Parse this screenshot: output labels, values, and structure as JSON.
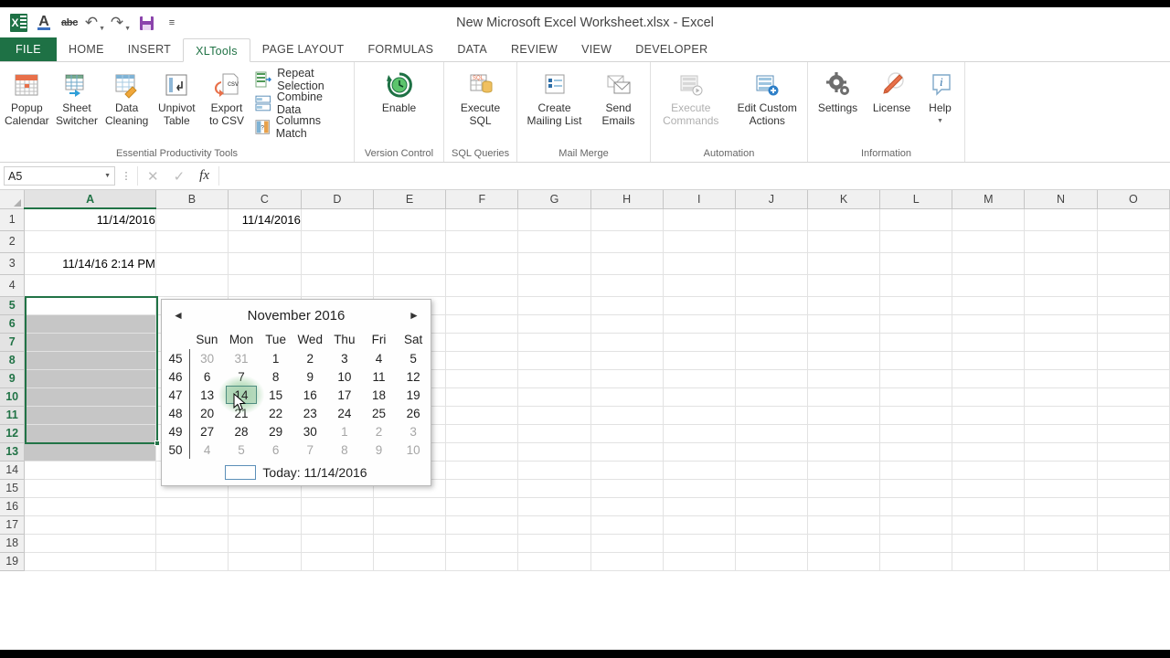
{
  "window": {
    "title": "New Microsoft Excel Worksheet.xlsx - Excel"
  },
  "quick_access": {
    "items": [
      {
        "name": "excel-logo",
        "label": "X"
      },
      {
        "name": "font-color-icon",
        "label": "A"
      },
      {
        "name": "strikethrough-icon",
        "label": "abc"
      },
      {
        "name": "undo-icon",
        "label": "↶"
      },
      {
        "name": "redo-icon",
        "label": "↷"
      },
      {
        "name": "save-icon",
        "label": "save"
      },
      {
        "name": "customize-qat-icon",
        "label": "≡"
      }
    ]
  },
  "ribbon": {
    "tabs": [
      {
        "label": "FILE",
        "active": false,
        "file": true
      },
      {
        "label": "HOME",
        "active": false
      },
      {
        "label": "INSERT",
        "active": false
      },
      {
        "label": "XLTools",
        "active": true
      },
      {
        "label": "PAGE LAYOUT",
        "active": false
      },
      {
        "label": "FORMULAS",
        "active": false
      },
      {
        "label": "DATA",
        "active": false
      },
      {
        "label": "REVIEW",
        "active": false
      },
      {
        "label": "VIEW",
        "active": false
      },
      {
        "label": "DEVELOPER",
        "active": false
      }
    ],
    "groups": [
      {
        "label": "Essential Productivity Tools",
        "big_buttons": [
          {
            "label_line1": "Popup",
            "label_line2": "Calendar",
            "icon": "calendar-icon",
            "disabled": false
          },
          {
            "label_line1": "Sheet",
            "label_line2": "Switcher",
            "icon": "sheet-switcher-icon",
            "disabled": false
          },
          {
            "label_line1": "Data",
            "label_line2": "Cleaning",
            "icon": "data-cleaning-icon",
            "disabled": false
          },
          {
            "label_line1": "Unpivot",
            "label_line2": "Table",
            "icon": "unpivot-table-icon",
            "disabled": false
          },
          {
            "label_line1": "Export",
            "label_line2": "to CSV",
            "icon": "export-csv-icon",
            "disabled": false
          }
        ],
        "small_buttons": [
          {
            "label": "Repeat Selection",
            "icon": "repeat-selection-icon"
          },
          {
            "label": "Combine Data",
            "icon": "combine-data-icon"
          },
          {
            "label": "Columns Match",
            "icon": "columns-match-icon"
          }
        ]
      },
      {
        "label": "Version Control",
        "big_buttons": [
          {
            "label_line1": "Enable",
            "label_line2": "",
            "icon": "enable-version-control-icon",
            "disabled": false
          }
        ],
        "small_buttons": []
      },
      {
        "label": "SQL Queries",
        "big_buttons": [
          {
            "label_line1": "Execute",
            "label_line2": "SQL",
            "icon": "execute-sql-icon",
            "disabled": false
          }
        ],
        "small_buttons": []
      },
      {
        "label": "Mail Merge",
        "big_buttons": [
          {
            "label_line1": "Create",
            "label_line2": "Mailing List",
            "icon": "create-mailing-list-icon",
            "disabled": false
          },
          {
            "label_line1": "Send",
            "label_line2": "Emails",
            "icon": "send-emails-icon",
            "disabled": false
          }
        ],
        "small_buttons": []
      },
      {
        "label": "Automation",
        "big_buttons": [
          {
            "label_line1": "Execute",
            "label_line2": "Commands",
            "icon": "execute-commands-icon",
            "disabled": true
          },
          {
            "label_line1": "Edit Custom",
            "label_line2": "Actions",
            "icon": "edit-custom-actions-icon",
            "disabled": false
          }
        ],
        "small_buttons": []
      },
      {
        "label": "Information",
        "big_buttons": [
          {
            "label_line1": "Settings",
            "label_line2": "",
            "icon": "settings-gear-icon",
            "disabled": false
          },
          {
            "label_line1": "License",
            "label_line2": "",
            "icon": "license-key-icon",
            "disabled": false
          },
          {
            "label_line1": "Help",
            "label_line2": "",
            "icon": "help-info-icon",
            "disabled": false,
            "has_dropdown": true
          }
        ],
        "small_buttons": []
      }
    ]
  },
  "formula_bar": {
    "name_box_value": "A5",
    "cancel_icon": "✕",
    "confirm_icon": "✓",
    "function_icon": "fx",
    "formula_value": "",
    "formula_placeholder": ""
  },
  "sheet": {
    "columns": [
      "A",
      "B",
      "C",
      "D",
      "E",
      "F",
      "G",
      "H",
      "I",
      "J",
      "K",
      "L",
      "M",
      "N",
      "O"
    ],
    "selected_column": "A",
    "rows": [
      1,
      2,
      3,
      4,
      5,
      6,
      7,
      8,
      9,
      10,
      11,
      12,
      13,
      14,
      15,
      16,
      17,
      18,
      19
    ],
    "selected_rows": [
      5,
      6,
      7,
      8,
      9,
      10,
      11,
      12,
      13
    ],
    "cells": [
      {
        "row": 1,
        "col": "A",
        "value": "11/14/2016",
        "align": "right"
      },
      {
        "row": 1,
        "col": "C",
        "value": "11/14/2016",
        "align": "right"
      },
      {
        "row": 3,
        "col": "A",
        "value": "11/14/16 2:14 PM",
        "align": "right"
      }
    ],
    "selection_range": "A5:A13",
    "active_cell": "A5"
  },
  "calendar": {
    "prev_icon": "◄",
    "next_icon": "►",
    "title": "November 2016",
    "weekday_headers": [
      "Sun",
      "Mon",
      "Tue",
      "Wed",
      "Thu",
      "Fri",
      "Sat"
    ],
    "weeks": [
      {
        "week_number": "45",
        "days": [
          {
            "d": "30",
            "out": true
          },
          {
            "d": "31",
            "out": true
          },
          {
            "d": "1"
          },
          {
            "d": "2"
          },
          {
            "d": "3"
          },
          {
            "d": "4"
          },
          {
            "d": "5"
          }
        ]
      },
      {
        "week_number": "46",
        "days": [
          {
            "d": "6"
          },
          {
            "d": "7"
          },
          {
            "d": "8"
          },
          {
            "d": "9"
          },
          {
            "d": "10"
          },
          {
            "d": "11"
          },
          {
            "d": "12"
          }
        ]
      },
      {
        "week_number": "47",
        "days": [
          {
            "d": "13"
          },
          {
            "d": "14",
            "hovered": true
          },
          {
            "d": "15"
          },
          {
            "d": "16"
          },
          {
            "d": "17"
          },
          {
            "d": "18"
          },
          {
            "d": "19"
          }
        ]
      },
      {
        "week_number": "48",
        "days": [
          {
            "d": "20"
          },
          {
            "d": "21"
          },
          {
            "d": "22"
          },
          {
            "d": "23"
          },
          {
            "d": "24"
          },
          {
            "d": "25"
          },
          {
            "d": "26"
          }
        ]
      },
      {
        "week_number": "49",
        "days": [
          {
            "d": "27"
          },
          {
            "d": "28"
          },
          {
            "d": "29"
          },
          {
            "d": "30"
          },
          {
            "d": "1",
            "out": true
          },
          {
            "d": "2",
            "out": true
          },
          {
            "d": "3",
            "out": true
          }
        ]
      },
      {
        "week_number": "50",
        "days": [
          {
            "d": "4",
            "out": true
          },
          {
            "d": "5",
            "out": true
          },
          {
            "d": "6",
            "out": true
          },
          {
            "d": "7",
            "out": true
          },
          {
            "d": "8",
            "out": true
          },
          {
            "d": "9",
            "out": true
          },
          {
            "d": "10",
            "out": true
          }
        ]
      }
    ],
    "today_label": "Today: 11/14/2016"
  },
  "colors": {
    "excel_green": "#1e7145",
    "accent_green": "#217346",
    "selection_shade": "#c6c6c6",
    "hover_green": "#afd6b7",
    "hover_border": "#4e8d80"
  }
}
